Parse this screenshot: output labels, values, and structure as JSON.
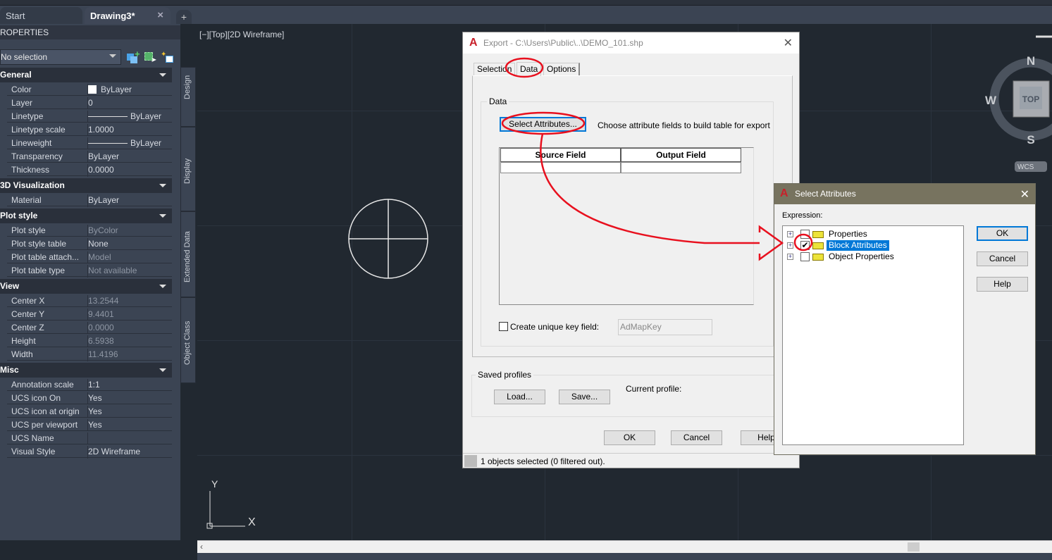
{
  "tabs": {
    "start": "Start",
    "drawing": "Drawing3*",
    "close": "×",
    "plus": "+"
  },
  "palette": {
    "title": "ROPERTIES",
    "selection": "No selection",
    "sections": [
      {
        "title": "General",
        "rows": [
          [
            "Color",
            "ByLayer"
          ],
          [
            "Layer",
            "0"
          ],
          [
            "Linetype",
            "ByLayer"
          ],
          [
            "Linetype scale",
            "1.0000"
          ],
          [
            "Lineweight",
            "ByLayer"
          ],
          [
            "Transparency",
            "ByLayer"
          ],
          [
            "Thickness",
            "0.0000"
          ]
        ]
      },
      {
        "title": "3D Visualization",
        "rows": [
          [
            "Material",
            "ByLayer"
          ]
        ]
      },
      {
        "title": "Plot style",
        "rows": [
          [
            "Plot style",
            "ByColor"
          ],
          [
            "Plot style table",
            "None"
          ],
          [
            "Plot table attach...",
            "Model"
          ],
          [
            "Plot table type",
            "Not available"
          ]
        ]
      },
      {
        "title": "View",
        "rows": [
          [
            "Center X",
            "13.2544"
          ],
          [
            "Center Y",
            "9.4401"
          ],
          [
            "Center Z",
            "0.0000"
          ],
          [
            "Height",
            "6.5938"
          ],
          [
            "Width",
            "11.4196"
          ]
        ]
      },
      {
        "title": "Misc",
        "rows": [
          [
            "Annotation scale",
            "1:1"
          ],
          [
            "UCS icon On",
            "Yes"
          ],
          [
            "UCS icon at origin",
            "Yes"
          ],
          [
            "UCS per viewport",
            "Yes"
          ],
          [
            "UCS Name",
            ""
          ],
          [
            "Visual Style",
            "2D Wireframe"
          ]
        ]
      }
    ],
    "side_tabs": [
      "Design",
      "Display",
      "Extended Data",
      "Object Class"
    ]
  },
  "viewport": {
    "label": "[−][Top][2D Wireframe]",
    "viewcube": {
      "n": "N",
      "s": "S",
      "w": "W",
      "top": "TOP",
      "wcs": "WCS"
    },
    "ucs": {
      "x": "X",
      "y": "Y"
    }
  },
  "export_dialog": {
    "title": "Export - C:\\Users\\Public\\..\\DEMO_101.shp",
    "tabs": [
      "Selection",
      "Data",
      "Options"
    ],
    "active_tab": "Data",
    "data_group": "Data",
    "select_attributes": "Select Attributes...",
    "hint": "Choose attribute fields to build table for export",
    "table_headers": [
      "Source Field",
      "Output Field"
    ],
    "unique_key_label": "Create unique key field:",
    "unique_key_value": "AdMapKey",
    "saved_profiles": "Saved profiles",
    "load": "Load...",
    "save": "Save...",
    "current_profile": "Current profile:",
    "ok": "OK",
    "cancel": "Cancel",
    "help": "Help",
    "status": "1 objects selected (0 filtered out)."
  },
  "select_attributes_dialog": {
    "title": "Select Attributes",
    "expression_label": "Expression:",
    "items": [
      {
        "label": "Properties",
        "checked": false
      },
      {
        "label": "Block Attributes",
        "checked": true,
        "selected": true
      },
      {
        "label": "Object Properties",
        "checked": false
      }
    ],
    "ok": "OK",
    "cancel": "Cancel",
    "help": "Help"
  },
  "colors": {
    "annotation": "#e8101e",
    "accent": "#0078d7",
    "canvas": "#212830"
  }
}
